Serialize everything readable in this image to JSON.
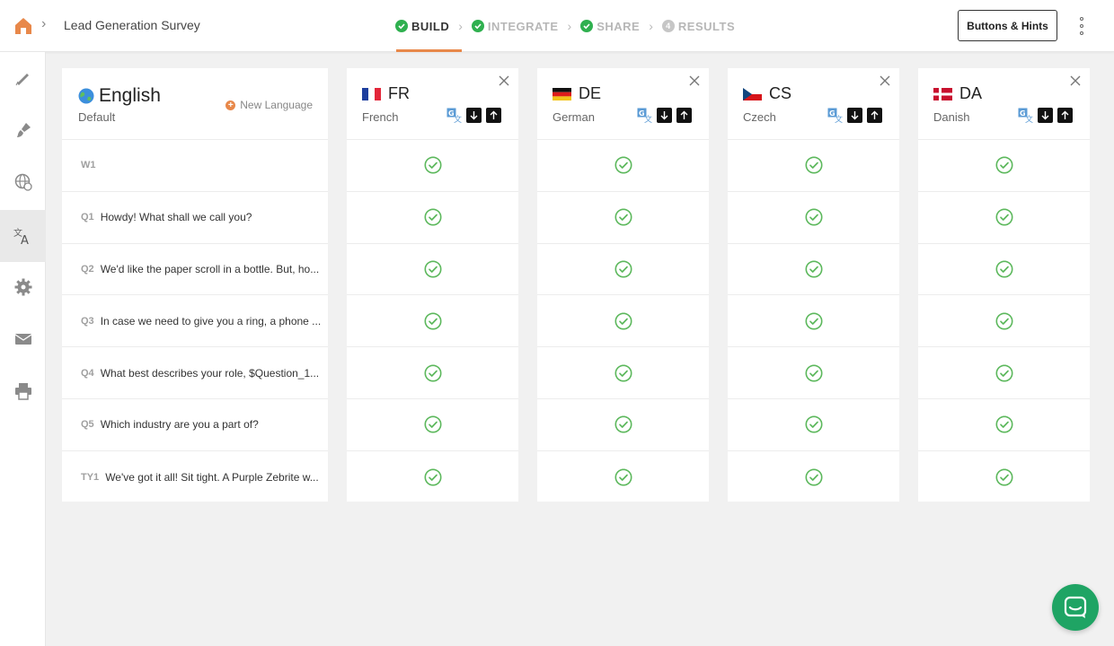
{
  "breadcrumb": {
    "title": "Lead Generation Survey"
  },
  "steps": [
    {
      "label": "BUILD",
      "status": "done",
      "active": true
    },
    {
      "label": "INTEGRATE",
      "status": "done",
      "active": false
    },
    {
      "label": "SHARE",
      "status": "done",
      "active": false
    },
    {
      "label": "RESULTS",
      "status": "pending",
      "number": "4",
      "active": false
    }
  ],
  "header": {
    "hints_button": "Buttons & Hints"
  },
  "sidebar": {
    "items": [
      {
        "name": "edit",
        "icon": "pencil-icon"
      },
      {
        "name": "design",
        "icon": "paint-brush-icon"
      },
      {
        "name": "languages",
        "icon": "globe-icon"
      },
      {
        "name": "translate",
        "icon": "translate-icon",
        "active": true
      },
      {
        "name": "settings",
        "icon": "gear-icon"
      },
      {
        "name": "email",
        "icon": "envelope-icon"
      },
      {
        "name": "print",
        "icon": "printer-icon"
      }
    ]
  },
  "base_language": {
    "name": "English",
    "sub": "Default",
    "new_language": "New Language"
  },
  "questions": [
    {
      "id": "W1",
      "text": ""
    },
    {
      "id": "Q1",
      "text": "Howdy! What shall we call you?"
    },
    {
      "id": "Q2",
      "text": "We'd like the paper scroll in a bottle. But, ho..."
    },
    {
      "id": "Q3",
      "text": "In case we need to give you a ring, a phone ..."
    },
    {
      "id": "Q4",
      "text": "What best describes your role, $Question_1..."
    },
    {
      "id": "Q5",
      "text": "Which industry are you a part of?"
    },
    {
      "id": "TY1",
      "text": "We've got it all! Sit tight. A Purple Zebrite w..."
    }
  ],
  "languages": [
    {
      "code": "FR",
      "name": "French",
      "flag": "fr"
    },
    {
      "code": "DE",
      "name": "German",
      "flag": "de"
    },
    {
      "code": "CS",
      "name": "Czech",
      "flag": "cs"
    },
    {
      "code": "DA",
      "name": "Danish",
      "flag": "da"
    }
  ],
  "colors": {
    "accent": "#e8884a",
    "success": "#2fb04f",
    "check": "#5cb85c",
    "chat": "#1fa464"
  }
}
